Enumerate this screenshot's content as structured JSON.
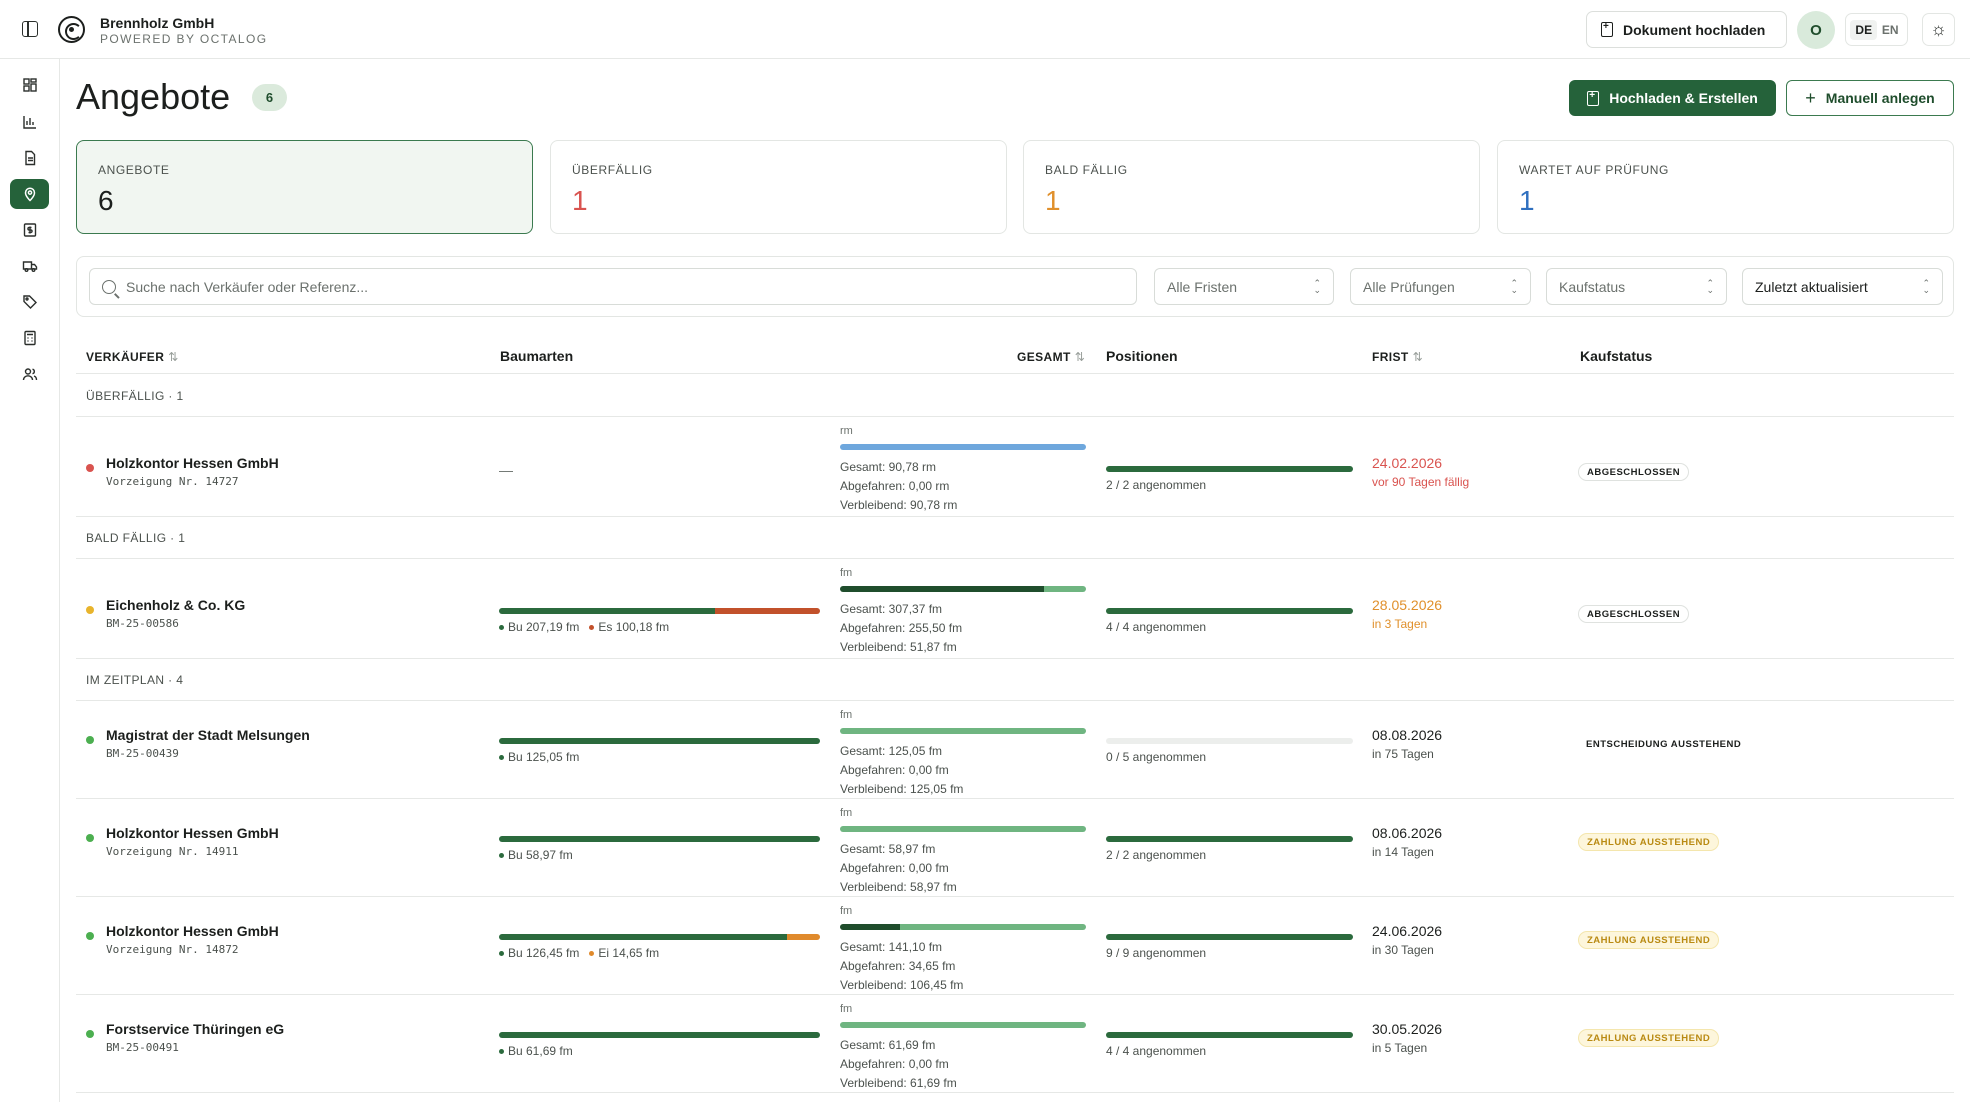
{
  "app": {
    "company": "Brennholz GmbH",
    "powered_by": "POWERED BY OCTALOG",
    "upload_doc_label": "Dokument hochladen",
    "avatar_initial": "O",
    "lang_de": "DE",
    "lang_en": "EN",
    "theme_icon": "sun-icon"
  },
  "sidebar": {
    "items": [
      {
        "icon": "dashboard-icon"
      },
      {
        "icon": "chart-icon"
      },
      {
        "icon": "document-icon"
      },
      {
        "icon": "location-pin-icon",
        "active": true
      },
      {
        "icon": "money-icon"
      },
      {
        "icon": "truck-icon"
      },
      {
        "icon": "tag-icon"
      },
      {
        "icon": "calculator-icon"
      },
      {
        "icon": "users-icon"
      }
    ]
  },
  "page": {
    "title": "Angebote",
    "count": "6",
    "btn_upload_create": "Hochladen & Erstellen",
    "btn_manual": "Manuell anlegen"
  },
  "stats": [
    {
      "label": "ANGEBOTE",
      "value": "6",
      "color": "#1c1f1d"
    },
    {
      "label": "ÜBERFÄLLIG",
      "value": "1",
      "color": "#d9534f"
    },
    {
      "label": "BALD FÄLLIG",
      "value": "1",
      "color": "#e0902c"
    },
    {
      "label": "WARTET AUF PRÜFUNG",
      "value": "1",
      "color": "#2f6fbf"
    }
  ],
  "filters": {
    "search_placeholder": "Suche nach Verkäufer oder Referenz...",
    "deadlines": "Alle Fristen",
    "reviews": "Alle Prüfungen",
    "purchase_status": "Kaufstatus",
    "sort": "Zuletzt aktualisiert"
  },
  "table": {
    "headers": {
      "seller": "VERKÄUFER",
      "species": "Baumarten",
      "total": "GESAMT",
      "positions": "Positionen",
      "deadline": "FRIST",
      "status": "Kaufstatus"
    },
    "groups": {
      "overdue": "ÜBERFÄLLIG · 1",
      "soon": "BALD FÄLLIG · 1",
      "scheduled": "IM ZEITPLAN · 4"
    },
    "rows": [
      {
        "seller": "Holzkontor Hessen GmbH",
        "ref": "Vorzeigung Nr. 14727",
        "dot_color": "#d9534f",
        "species_empty": "—",
        "unit": "rm",
        "total": "Gesamt: 90,78 rm",
        "collected": "Abgefahren: 0,00 rm",
        "remaining": "Verbleibend: 90,78 rm",
        "total_collected_share": 0,
        "total_bar_color": "#6ea7dd",
        "positions": "2 / 2 angenommen",
        "positions_share": 1,
        "due": "24.02.2026",
        "due_sub": "vor 90 Tagen fällig",
        "due_color": "#d9534f",
        "status": "ABGESCHLOSSEN",
        "status_kind": "done"
      },
      {
        "seller": "Eichenholz & Co. KG",
        "ref": "BM-25-00586",
        "dot_color": "#e8b42c",
        "species": [
          {
            "label": "Bu 207,19 fm",
            "value": 207.19,
            "color": "#2b6a3d"
          },
          {
            "label": "Es 100,18 fm",
            "value": 100.18,
            "color": "#c2512b"
          }
        ],
        "unit": "fm",
        "total": "Gesamt: 307,37 fm",
        "collected": "Abgefahren: 255,50 fm",
        "remaining": "Verbleibend: 51,87 fm",
        "total_collected_share": 0.8312,
        "positions": "4 / 4 angenommen",
        "positions_share": 1,
        "due": "28.05.2026",
        "due_sub": "in 3 Tagen",
        "due_color": "#e0902c",
        "status": "ABGESCHLOSSEN",
        "status_kind": "done"
      },
      {
        "seller": "Magistrat der Stadt Melsungen",
        "ref": "BM-25-00439",
        "dot_color": "#4caf50",
        "species": [
          {
            "label": "Bu 125,05 fm",
            "value": 125.05,
            "color": "#2b6a3d"
          }
        ],
        "unit": "fm",
        "total": "Gesamt: 125,05 fm",
        "collected": "Abgefahren: 0,00 fm",
        "remaining": "Verbleibend: 125,05 fm",
        "total_collected_share": 0,
        "positions": "0 / 5 angenommen",
        "positions_share": 0,
        "due": "08.08.2026",
        "due_sub": "in 75 Tagen",
        "due_color": "#1c1f1d",
        "status": "ENTSCHEIDUNG AUSSTEHEND",
        "status_kind": "open"
      },
      {
        "seller": "Holzkontor Hessen GmbH",
        "ref": "Vorzeigung Nr. 14911",
        "dot_color": "#4caf50",
        "species": [
          {
            "label": "Bu 58,97 fm",
            "value": 58.97,
            "color": "#2b6a3d"
          }
        ],
        "unit": "fm",
        "total": "Gesamt: 58,97 fm",
        "collected": "Abgefahren: 0,00 fm",
        "remaining": "Verbleibend: 58,97 fm",
        "total_collected_share": 0,
        "positions": "2 / 2 angenommen",
        "positions_share": 1,
        "due": "08.06.2026",
        "due_sub": "in 14 Tagen",
        "due_color": "#1c1f1d",
        "status": "ZAHLUNG AUSSTEHEND",
        "status_kind": "pay"
      },
      {
        "seller": "Holzkontor Hessen GmbH",
        "ref": "Vorzeigung Nr. 14872",
        "dot_color": "#4caf50",
        "species": [
          {
            "label": "Bu 126,45 fm",
            "value": 126.45,
            "color": "#2b6a3d"
          },
          {
            "label": "Ei 14,65 fm",
            "value": 14.65,
            "color": "#e08a2c"
          }
        ],
        "unit": "fm",
        "total": "Gesamt: 141,10 fm",
        "collected": "Abgefahren: 34,65 fm",
        "remaining": "Verbleibend: 106,45 fm",
        "total_collected_share": 0.2456,
        "positions": "9 / 9 angenommen",
        "positions_share": 1,
        "due": "24.06.2026",
        "due_sub": "in 30 Tagen",
        "due_color": "#1c1f1d",
        "status": "ZAHLUNG AUSSTEHEND",
        "status_kind": "pay"
      },
      {
        "seller": "Forstservice Thüringen eG",
        "ref": "BM-25-00491",
        "dot_color": "#4caf50",
        "species": [
          {
            "label": "Bu 61,69 fm",
            "value": 61.69,
            "color": "#2b6a3d"
          }
        ],
        "unit": "fm",
        "total": "Gesamt: 61,69 fm",
        "collected": "Abgefahren: 0,00 fm",
        "remaining": "Verbleibend: 61,69 fm",
        "total_collected_share": 0,
        "positions": "4 / 4 angenommen",
        "positions_share": 1,
        "due": "30.05.2026",
        "due_sub": "in 5 Tagen",
        "due_color": "#1c1f1d",
        "status": "ZAHLUNG AUSSTEHEND",
        "status_kind": "pay"
      }
    ]
  }
}
